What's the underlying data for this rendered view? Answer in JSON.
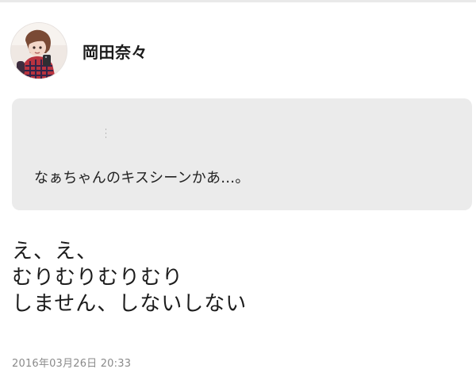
{
  "post": {
    "author": {
      "name": "岡田奈々",
      "avatar_icon": "profile-photo-icon"
    },
    "quote": {
      "text": "なぁちゃんのキスシーンかあ…。"
    },
    "body_lines": [
      "え、え、",
      "むりむりむりむり",
      "しません、しないしない"
    ],
    "timestamp": "2016年03月26日 20:33"
  },
  "colors": {
    "background": "#ffffff",
    "quote_card_background": "#ebebeb",
    "body_text": "#1c1c1c",
    "timestamp_text": "#8a8a8a",
    "top_rule": "#e9e9e9"
  }
}
